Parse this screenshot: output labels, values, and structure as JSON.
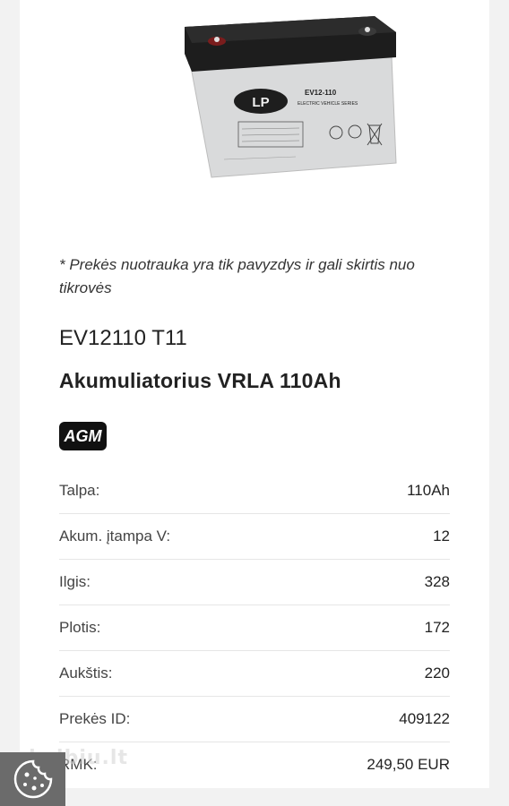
{
  "product": {
    "image_alt": "LP EV12-110 battery",
    "image_brand": "LP",
    "image_model": "EV12-110",
    "image_series": "ELECTRIC VEHICLE SERIES",
    "disclaimer": "* Prekės nuotrauka yra tik pavyzdys ir gali skirtis nuo tikrovės",
    "sku": "EV12110 T11",
    "title": "Akumuliatorius VRLA 110Ah",
    "badge": "AGM"
  },
  "specs": [
    {
      "label": "Talpa:",
      "value": "110Ah"
    },
    {
      "label": "Akum. įtampa V:",
      "value": "12"
    },
    {
      "label": "Ilgis:",
      "value": "328"
    },
    {
      "label": "Plotis:",
      "value": "172"
    },
    {
      "label": "Aukštis:",
      "value": "220"
    },
    {
      "label": "Prekės ID:",
      "value": "409122"
    },
    {
      "label": "RMK:",
      "value": "249,50 EUR"
    }
  ],
  "watermark": "skelbiu.lt",
  "colors": {
    "badge_bg": "#111111",
    "page_bg": "#f2f2f2",
    "cookie_bg": "#6b6b6b"
  }
}
